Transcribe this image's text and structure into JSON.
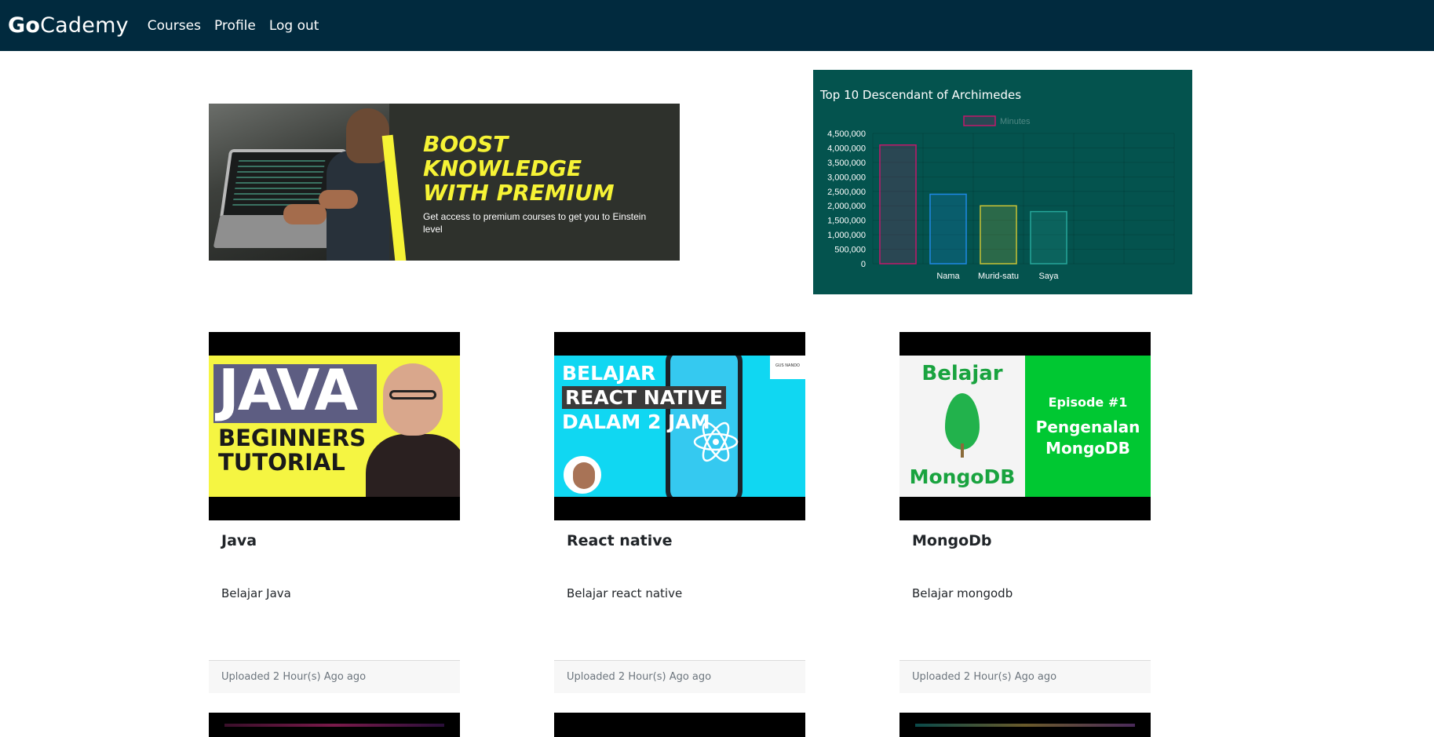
{
  "navbar": {
    "brand_bold": "Go",
    "brand_rest": "Cademy",
    "links": [
      "Courses",
      "Profile",
      "Log out"
    ],
    "background": "#012a3e"
  },
  "banner": {
    "title": "BOOST\nKNOWLEDGE\nWITH PREMIUM",
    "subtitle": "Get access to premium courses to get you to Einstein level",
    "accent": "#f6f335"
  },
  "chart_data": {
    "type": "bar",
    "title": "Top 10 Descendant of Archimedes",
    "legend": [
      "Minutes"
    ],
    "legend_position": "top",
    "categories": [
      "",
      "Nama",
      "Murid-satu",
      "Saya",
      "",
      ""
    ],
    "series": [
      {
        "name": "Minutes",
        "values": [
          4100000,
          2400000,
          2000000,
          1800000,
          null,
          null
        ]
      }
    ],
    "bar_colors": [
      "#c2186b",
      "#1e88e5",
      "#c8c235",
      "#26a69a"
    ],
    "yticks": [
      "0",
      "500,000",
      "1,000,000",
      "1,500,000",
      "2,000,000",
      "2,500,000",
      "3,000,000",
      "3,500,000",
      "4,000,000",
      "4,500,000"
    ],
    "ylim": [
      0,
      4500000
    ],
    "grid": true,
    "background": "#04534e"
  },
  "courses": [
    {
      "title": "Java",
      "description": "Belajar Java",
      "uploaded": "Uploaded 2 Hour(s) Ago ago",
      "thumb": {
        "word": "JAVA",
        "sub": "BEGINNERS\nTUTORIAL"
      }
    },
    {
      "title": "React native",
      "description": "Belajar react native",
      "uploaded": "Uploaded 2 Hour(s) Ago ago",
      "thumb": {
        "line1": "BELAJAR",
        "line2": "REACT NATIVE",
        "line3": "DALAM 2 JAM",
        "tag": "GUS NANDO"
      }
    },
    {
      "title": "MongoDb",
      "description": "Belajar mongodb",
      "uploaded": "Uploaded 2 Hour(s) Ago ago",
      "thumb": {
        "top": "Belajar",
        "name": "MongoDB",
        "episode": "Episode #1",
        "intro": "Pengenalan\nMongoDB"
      }
    }
  ]
}
